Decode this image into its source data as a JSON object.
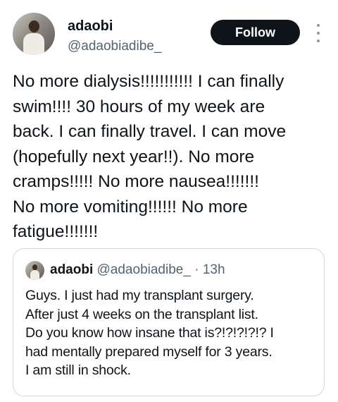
{
  "tweet": {
    "author_name": "adaobi",
    "author_handle": "@adaobiadibe_",
    "follow_label": "Follow",
    "text": "No more dialysis!!!!!!!!!!! I can finally\nswim!!!! 30 hours of my week are\nback. I can finally travel. I can move\n(hopefully next year!!). No more\ncramps!!!!! No more nausea!!!!!!!\nNo more vomiting!!!!!! No more\nfatigue!!!!!!!"
  },
  "quoted_tweet": {
    "author_name": "adaobi",
    "author_handle": "@adaobiadibe_",
    "separator": "·",
    "time": "13h",
    "text": "Guys. I just had my transplant surgery.\nAfter just 4 weeks on the transplant list.\nDo you know how insane that is?!?!?!?!? I\nhad mentally prepared myself for 3 years.\nI am still in shock."
  },
  "icons": {
    "more": "more-vertical-icon"
  },
  "colors": {
    "follow_button": "#0f1419",
    "secondary_text": "#536471",
    "quote_border": "#cfd9de"
  }
}
